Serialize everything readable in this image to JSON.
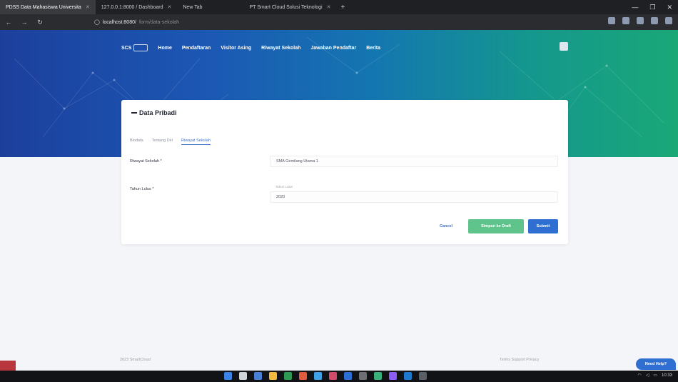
{
  "browser": {
    "tabs": [
      {
        "label": "PDSS Data Mahasiswa Universita",
        "active": true
      },
      {
        "label": "127.0.0.1:8000 / Dashboard",
        "active": false
      },
      {
        "label": "New Tab",
        "active": false
      },
      {
        "label": "PT Smart Cloud Solusi Teknologi",
        "active": false
      }
    ],
    "url": "localhost:8080/",
    "url_rest": "form/data-sekolah"
  },
  "site": {
    "logo_text": "SCS",
    "nav": [
      "Home",
      "Pendaftaran",
      "Visitor Asing",
      "Riwayat Sekolah",
      "Jawaban Pendaftar",
      "Berita"
    ]
  },
  "card": {
    "title": "Data Pribadi",
    "tabs": [
      {
        "label": "Biodata",
        "active": false
      },
      {
        "label": "Tentang Diri",
        "active": false
      },
      {
        "label": "Riwayat Sekolah",
        "active": true
      }
    ],
    "fields": {
      "riwayat_label": "Riwayat Sekolah *",
      "riwayat_value": "SMA Gemilang Utama 1",
      "tahun_label": "Tahun Lulus *",
      "tahun_float": "Tahun Lulus",
      "tahun_value": "2020"
    },
    "buttons": {
      "cancel": "Cancel",
      "save_draft": "Simpan ke Draft",
      "submit": "Submit"
    }
  },
  "footer": {
    "left": "2023 SmartCloud",
    "right": "Terms   Support   Privacy"
  },
  "chat_button": "Need Help?",
  "tray": {
    "time": "10:33"
  }
}
